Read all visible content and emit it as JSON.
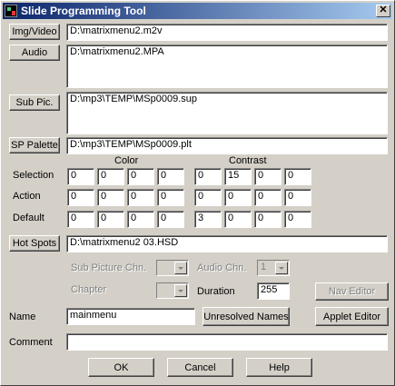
{
  "window": {
    "title": "Slide Programming Tool",
    "close_glyph": "✕"
  },
  "files": {
    "img_video": {
      "label": "Img/Video",
      "value": "D:\\matrixmenu2.m2v"
    },
    "audio": {
      "label": "Audio",
      "value": "D:\\matrixmenu2.MPA"
    },
    "sub_pic": {
      "label": "Sub Pic.",
      "value": "D:\\mp3\\TEMP\\MSp0009.sup"
    },
    "sp_palette": {
      "label": "SP Palette",
      "value": "D:\\mp3\\TEMP\\MSp0009.plt"
    }
  },
  "grid": {
    "color_header": "Color",
    "contrast_header": "Contrast",
    "rows": [
      {
        "label": "Selection",
        "color": [
          "0",
          "0",
          "0",
          "0"
        ],
        "contrast": [
          "0",
          "15",
          "0",
          "0"
        ]
      },
      {
        "label": "Action",
        "color": [
          "0",
          "0",
          "0",
          "0"
        ],
        "contrast": [
          "0",
          "0",
          "0",
          "0"
        ]
      },
      {
        "label": "Default",
        "color": [
          "0",
          "0",
          "0",
          "0"
        ],
        "contrast": [
          "3",
          "0",
          "0",
          "0"
        ]
      }
    ]
  },
  "hotspots": {
    "label": "Hot Spots",
    "value": "D:\\matrixmenu2 03.HSD"
  },
  "options": {
    "sub_picture_chn_label": "Sub Picture Chn.",
    "sub_picture_chn_value": "",
    "audio_chn_label": "Audio Chn.",
    "audio_chn_value": "1",
    "chapter_label": "Chapter",
    "chapter_value": "",
    "duration_label": "Duration",
    "duration_value": "255",
    "nav_editor_label": "Nav Editor"
  },
  "name": {
    "label": "Name",
    "value": "mainmenu",
    "unresolved_label": "Unresolved Names",
    "applet_label": "Applet Editor"
  },
  "comment": {
    "label": "Comment",
    "value": ""
  },
  "footer": {
    "ok": "OK",
    "cancel": "Cancel",
    "help": "Help"
  }
}
